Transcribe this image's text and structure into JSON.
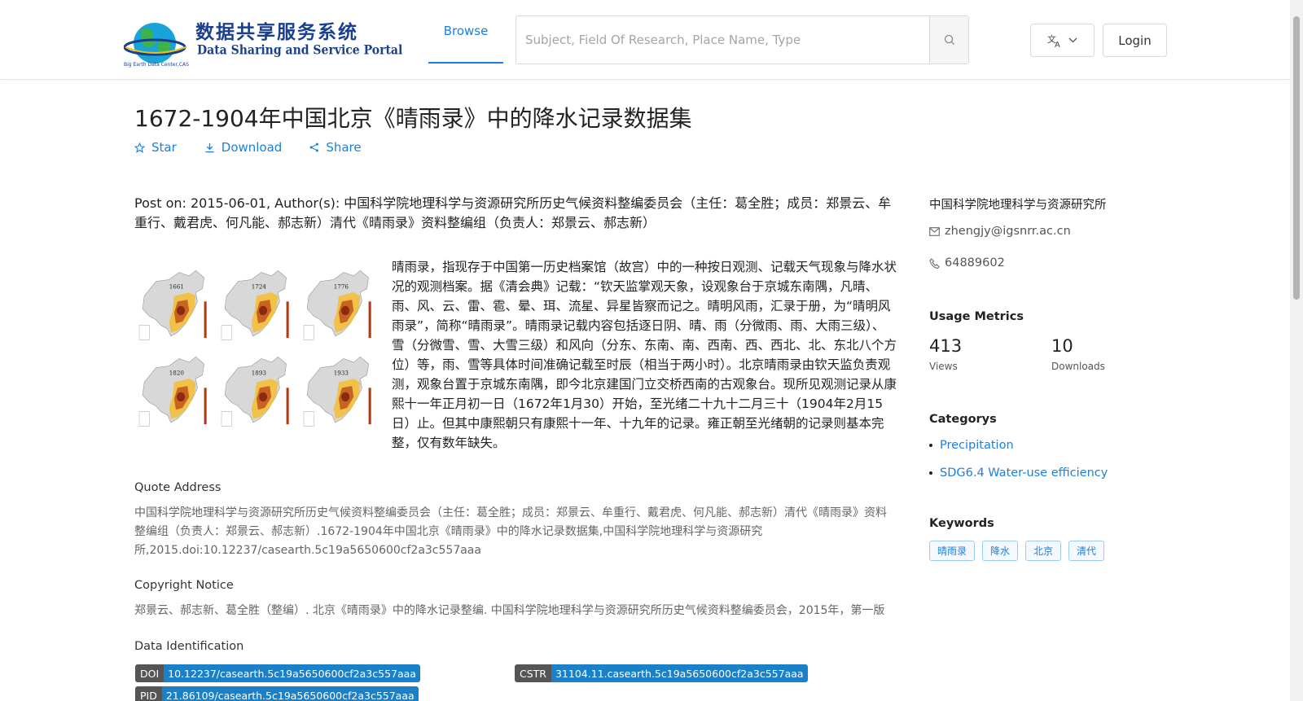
{
  "header": {
    "logo_cn": "数据共享服务系统",
    "logo_en": "Data Sharing and Service Portal",
    "logo_small": "Big Earth Data Center,CAS",
    "nav_browse": "Browse",
    "search_placeholder": "Subject, Field Of Research, Place Name, Type",
    "login_label": "Login",
    "icons": {
      "search": "search-icon",
      "language": "translate-icon",
      "dropdown": "chevron-down-icon"
    }
  },
  "dataset": {
    "title": "1672-1904年中国北京《晴雨录》中的降水记录数据集",
    "actions": [
      {
        "label": "Star",
        "icon": "star-icon"
      },
      {
        "label": "Download",
        "icon": "download-icon"
      },
      {
        "label": "Share",
        "icon": "share-icon"
      }
    ],
    "post_on": "Post on: 2015-06-01, Author(s): 中国科学院地理科学与资源研究所历史气候资料整编委员会（主任：葛全胜；成员：郑景云、牟重行、戴君虎、何凡能、郝志新）清代《晴雨录》资料整编组（负责人：郑景云、郝志新）",
    "thumbnail_years": [
      "1661",
      "1724",
      "1776",
      "1820",
      "1893",
      "1933"
    ],
    "description": "晴雨录，指现存于中国第一历史档案馆（故宫）中的一种按日观测、记载天气现象与降水状况的观测档案。据《清会典》记载：“钦天监掌观天象，设观象台于京城东南隅，凡晴、雨、风、云、雷、雹、晕、珥、流星、异星皆察而记之。晴明风雨，汇录于册，为“晴明风雨录”，简称“晴雨录”。晴雨录记载内容包括逐日阴、晴、雨（分微雨、雨、大雨三级）、雪（分微雪、雪、大雪三级）和风向（分东、东南、南、西南、西、西北、北、东北八个方位）等，雨、雪等具体时间准确记载至时辰（相当于两小时）。北京晴雨录由钦天监负责观测，观象台置于京城东南隅，即今北京建国门立交桥西南的古观象台。现所见观测记录从康熙十一年正月初一日（1672年1月30）开始，至光绪二十九十二月三十（1904年2月15日）止。但其中康熙朝只有康熙十一年、十九年的记录。雍正朝至光绪朝的记录则基本完整，仅有数年缺失。",
    "quote_heading": "Quote Address",
    "quote_text": "中国科学院地理科学与资源研究所历史气候资料整编委员会（主任：葛全胜；成员：郑景云、牟重行、戴君虎、何凡能、郝志新）清代《晴雨录》资料整编组（负责人：郑景云、郝志新）.1672-1904年中国北京《晴雨录》中的降水记录数据集,中国科学院地理科学与资源研究所,2015.doi:10.12237/casearth.5c19a5650600cf2a3c557aaa",
    "copyright_heading": "Copyright Notice",
    "copyright_text": "郑景云、郝志新、葛全胜（整编）. 北京《晴雨录》中的降水记录整编. 中国科学院地理科学与资源研究所历史气候资料整编委员会，2015年，第一版",
    "identification_heading": "Data Identification",
    "identifiers": [
      {
        "key": "DOI",
        "value": "10.12237/casearth.5c19a5650600cf2a3c557aaa"
      },
      {
        "key": "CSTR",
        "value": "31104.11.casearth.5c19a5650600cf2a3c557aaa"
      },
      {
        "key": "PID",
        "value": "21.86109/casearth.5c19a5650600cf2a3c557aaa"
      }
    ]
  },
  "sidebar": {
    "organization": "中国科学院地理科学与资源研究所",
    "email": "zhengjy@igsnrr.ac.cn",
    "phone": "64889602",
    "usage_heading": "Usage Metrics",
    "views": "413",
    "views_label": "Views",
    "downloads": "10",
    "downloads_label": "Downloads",
    "categories_heading": "Categorys",
    "categories": [
      "Precipitation",
      "SDG6.4 Water-use efficiency"
    ],
    "keywords_heading": "Keywords",
    "keywords": [
      "晴雨录",
      "降水",
      "北京",
      "清代"
    ]
  },
  "colors": {
    "accent": "#1d7fdb",
    "badge_key": "#555555",
    "badge_value": "#1a80c8"
  }
}
